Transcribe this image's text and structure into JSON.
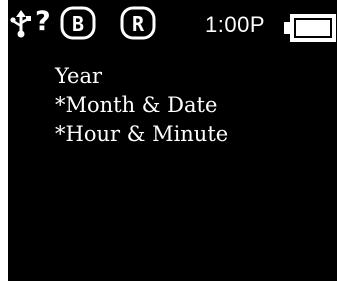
{
  "status_bar": {
    "usb_icon": "usb-connected-icon",
    "help_glyph": "?",
    "badge_b": "B",
    "badge_r": "R",
    "clock": "1:00P",
    "battery_icon": "battery-full-icon",
    "battery_level": 1.0
  },
  "menu": {
    "items": [
      {
        "label": "Year"
      },
      {
        "label": "*Month & Date"
      },
      {
        "label": "*Hour & Minute"
      }
    ]
  },
  "colors": {
    "screen_background": "#000000",
    "foreground": "#ffffff"
  }
}
